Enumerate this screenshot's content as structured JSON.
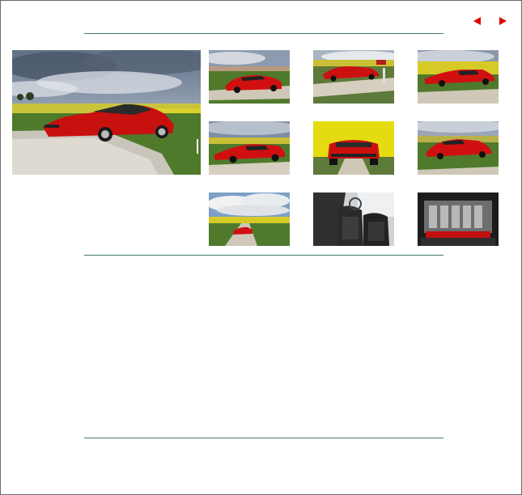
{
  "gallery": {
    "nav": {
      "prev_icon": "left-triangle-arrow-icon",
      "next_icon": "right-triangle-arrow-icon"
    },
    "main_photo": {
      "subject": "red-sports-car-photo"
    },
    "thumbnails": [
      {
        "id": 1,
        "scene": "front-three-quarter-sky"
      },
      {
        "id": 2,
        "scene": "side-on-dirt-road"
      },
      {
        "id": 3,
        "scene": "side-with-rapeseed-field"
      },
      {
        "id": 4,
        "scene": "side-low-angle-sky"
      },
      {
        "id": 5,
        "scene": "rear-view-yellow-field"
      },
      {
        "id": 6,
        "scene": "rear-three-quarter-grass"
      },
      {
        "id": 7,
        "scene": "distant-road-cloudy-sky"
      },
      {
        "id": 8,
        "scene": "interior-seats"
      },
      {
        "id": 9,
        "scene": "engine-bay"
      }
    ]
  },
  "colors": {
    "accent_red": "#e00000",
    "rule_green": "#3f7f5f",
    "frame_gray": "#6b6b6b"
  }
}
